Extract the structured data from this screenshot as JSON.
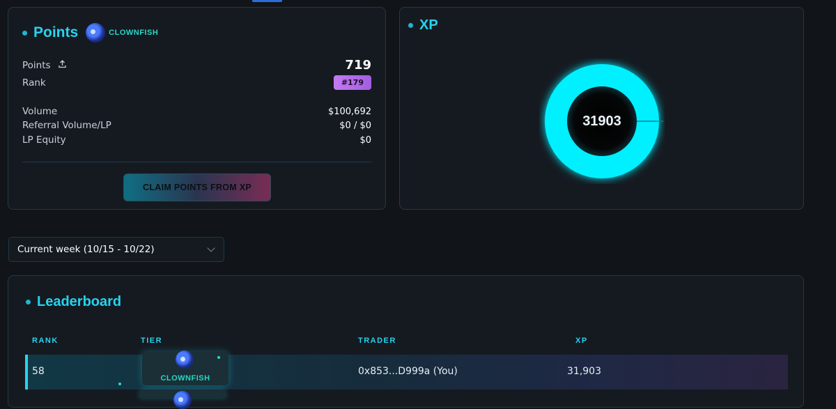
{
  "points_card": {
    "title": "Points",
    "tier": "CLOWNFISH",
    "points_label": "Points",
    "points_value": "719",
    "rank_label": "Rank",
    "rank_value": "#179",
    "volume_label": "Volume",
    "volume_value": "$100,692",
    "referral_label": "Referral Volume/LP",
    "referral_value": "$0 / $0",
    "lp_equity_label": "LP Equity",
    "lp_equity_value": "$0",
    "claim_button": "CLAIM POINTS FROM XP"
  },
  "xp_card": {
    "title": "XP",
    "value": "31903",
    "fill_fraction": 1.0,
    "ring_color": "#00f0ff"
  },
  "week_select": {
    "value": "Current week (10/15 - 10/22)"
  },
  "leaderboard": {
    "title": "Leaderboard",
    "columns": [
      "RANK",
      "TIER",
      "TRADER",
      "XP"
    ],
    "rows": [
      {
        "rank": "58",
        "tier": "CLOWNFISH",
        "trader": "0x853...D999a (You)",
        "xp": "31,903"
      }
    ]
  },
  "colors": {
    "accent": "#27d3ee",
    "background": "#111418",
    "card": "#151a21",
    "rank_badge": "#b96ae8"
  }
}
